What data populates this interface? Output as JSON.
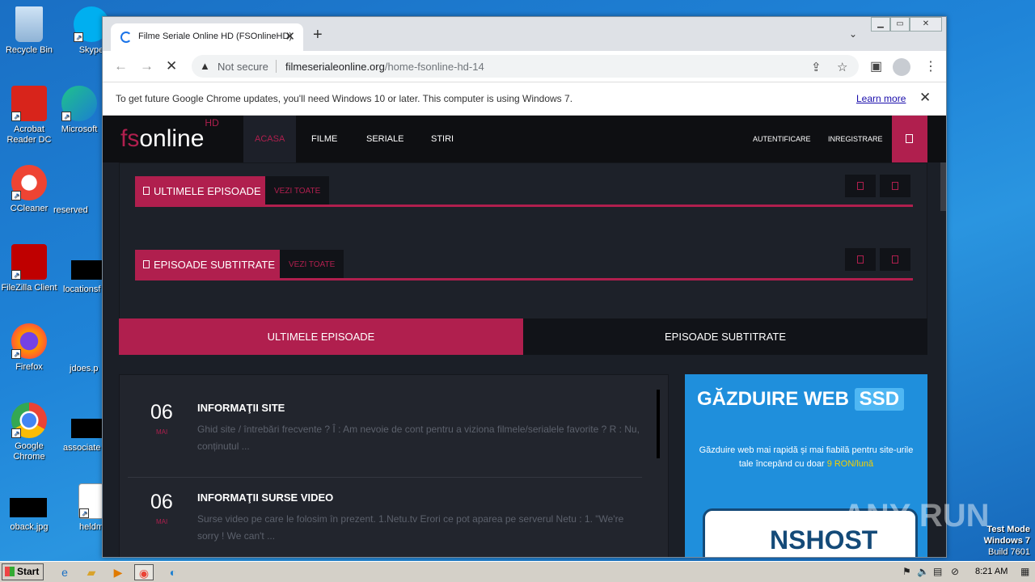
{
  "desktop": {
    "icons": [
      {
        "label": "Recycle Bin"
      },
      {
        "label": "Skype"
      },
      {
        "label": "Acrobat Reader DC"
      },
      {
        "label": "Microsoft"
      },
      {
        "label": "CCleaner"
      },
      {
        "label": "reserved"
      },
      {
        "label": "FileZilla Client"
      },
      {
        "label": "locationsf"
      },
      {
        "label": "Firefox"
      },
      {
        "label": "jdoes.p"
      },
      {
        "label": "Google Chrome"
      },
      {
        "label": "associate"
      },
      {
        "label": "oback.jpg"
      },
      {
        "label": "heldm"
      }
    ]
  },
  "browser": {
    "tab_title": "Filme Seriale Online HD (FSOnlineHD)",
    "security_label": "Not secure",
    "url_domain": "filmeserialeonline.org",
    "url_path": "/home-fsonline-hd-14",
    "infobar_message": "To get future Google Chrome updates, you'll need Windows 10 or later. This computer is using Windows 7.",
    "infobar_link": "Learn more"
  },
  "site": {
    "logo_fs": "fs",
    "logo_online": "online",
    "logo_hd": "HD",
    "nav": [
      "ACASA",
      "FILME",
      "SERIALE",
      "STIRI"
    ],
    "auth": [
      "AUTENTIFICARE",
      "INREGISTRARE"
    ],
    "sections": [
      {
        "title": "ULTIMELE EPISOADE",
        "link": "VEZI TOATE"
      },
      {
        "title": "EPISOADE SUBTITRATE",
        "link": "VEZI TOATE"
      }
    ],
    "tabs": [
      "ULTIMELE EPISOADE",
      "EPISOADE SUBTITRATE"
    ],
    "news": [
      {
        "day": "06",
        "month": "MAI",
        "title": "INFORMAŢII SITE",
        "desc": "Ghid site / întrebări frecvente ? Î : Am nevoie de cont pentru a viziona filmele/serialele favorite ? R : Nu, conținutul ..."
      },
      {
        "day": "06",
        "month": "MAI",
        "title": "INFORMAŢII SURSE VIDEO",
        "desc": "Surse video pe care le folosim în prezent.   1.Netu.tv Erori ce pot aparea pe serverul Netu : 1. \"We're sorry ! We can't ..."
      }
    ],
    "ad": {
      "headline": "GĂZDUIRE WEB",
      "badge": "SSD",
      "text": "Găzduire web mai rapidă și mai fiabilă pentru site-urile tale începând cu doar",
      "price": "9 RON/lună",
      "brand": "NSHOST"
    }
  },
  "watermark": "ANY RUN",
  "testmode": {
    "line1": "Test Mode",
    "line2": "Windows 7",
    "line3": "Build 7601"
  },
  "taskbar": {
    "start": "Start",
    "time": "8:21 AM"
  }
}
